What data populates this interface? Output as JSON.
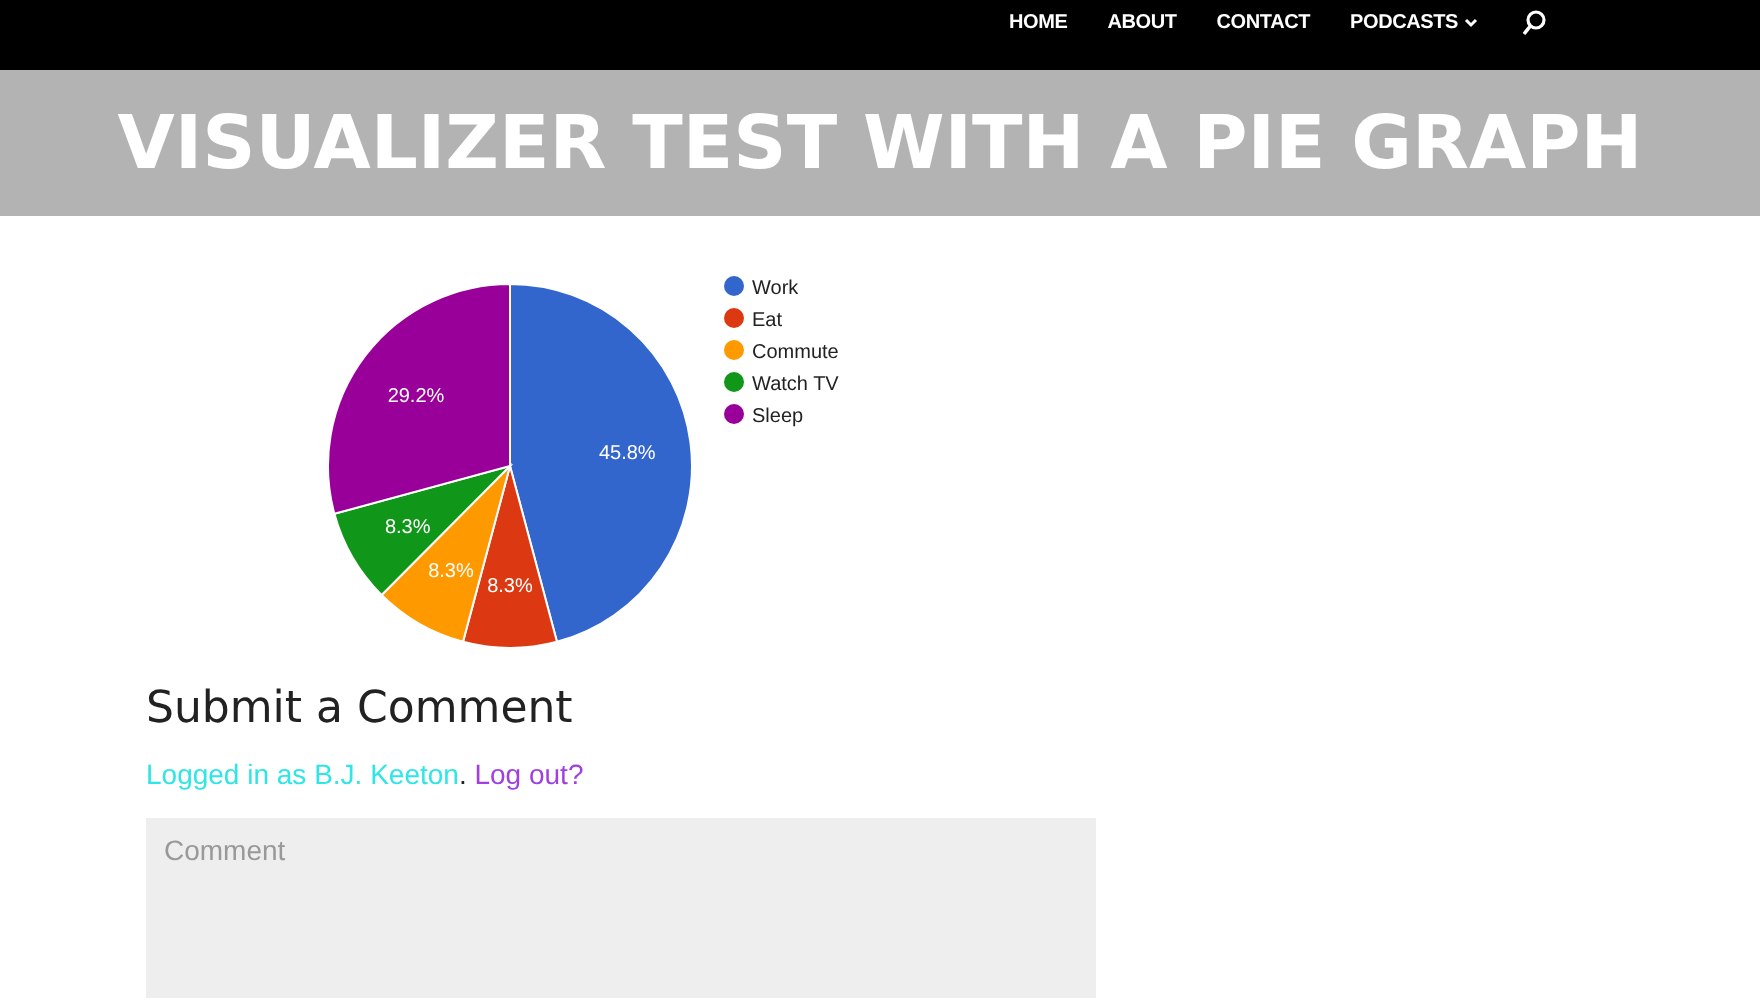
{
  "nav": {
    "items": [
      {
        "label": "HOME",
        "has_menu": false
      },
      {
        "label": "ABOUT",
        "has_menu": false
      },
      {
        "label": "CONTACT",
        "has_menu": false
      },
      {
        "label": "PODCASTS",
        "has_menu": true
      }
    ]
  },
  "banner": {
    "title": "VISUALIZER TEST WITH A PIE GRAPH"
  },
  "chart": {
    "chart_data": {
      "type": "pie",
      "categories": [
        "Work",
        "Eat",
        "Commute",
        "Watch TV",
        "Sleep"
      ],
      "values": [
        45.8,
        8.3,
        8.3,
        8.3,
        29.2
      ],
      "colors": [
        "#3366cc",
        "#dc3912",
        "#ff9900",
        "#109618",
        "#990099"
      ],
      "value_labels": [
        "45.8%",
        "8.3%",
        "8.3%",
        "8.3%",
        "29.2%"
      ],
      "legend": "right"
    }
  },
  "comments": {
    "heading": "Submit a Comment",
    "logged_in_prefix": "Logged in as B.J. Keeton",
    "separator": ".",
    "logout": "Log out?",
    "placeholder": "Comment"
  }
}
